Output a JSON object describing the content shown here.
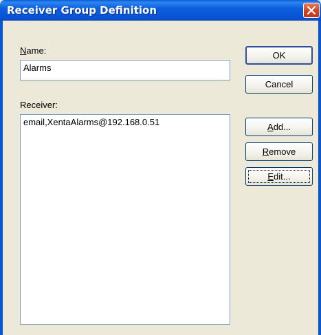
{
  "window": {
    "title": "Receiver Group Definition"
  },
  "icons": {
    "close": "close-icon"
  },
  "form": {
    "name_label_first": "N",
    "name_label_rest": "ame:",
    "name_value": "Alarms",
    "receiver_label": "Receiver:",
    "receivers": [
      "email,XentaAlarms@192.168.0.51"
    ]
  },
  "buttons": {
    "ok": "OK",
    "cancel": "Cancel",
    "add_first": "A",
    "add_rest": "dd...",
    "remove_first": "R",
    "remove_rest": "emove",
    "edit_first": "E",
    "edit_rest": "dit..."
  }
}
